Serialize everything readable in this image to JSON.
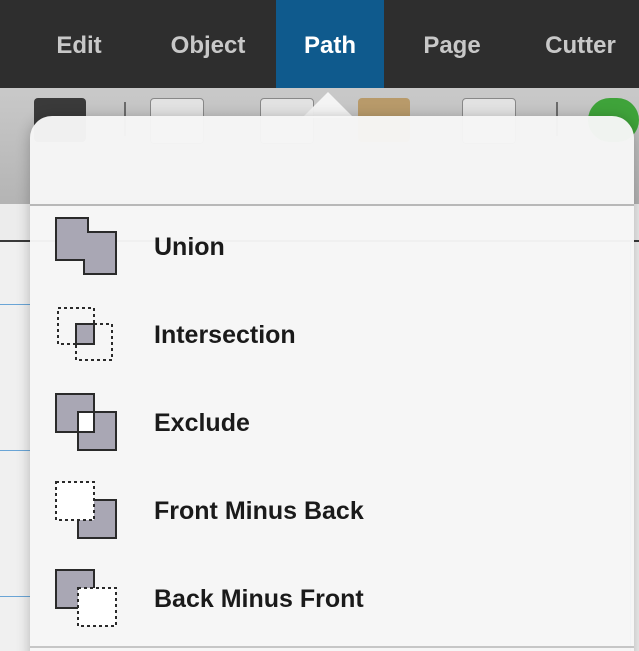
{
  "menubar": {
    "items": [
      {
        "label": "Edit",
        "active": false
      },
      {
        "label": "Object",
        "active": false
      },
      {
        "label": "Path",
        "active": true
      },
      {
        "label": "Page",
        "active": false
      },
      {
        "label": "Cutter",
        "active": false
      }
    ]
  },
  "path_menu": {
    "items": [
      {
        "label": "Union",
        "icon": "union-icon"
      },
      {
        "label": "Intersection",
        "icon": "intersection-icon"
      },
      {
        "label": "Exclude",
        "icon": "exclude-icon"
      },
      {
        "label": "Front Minus Back",
        "icon": "front-minus-back-icon"
      },
      {
        "label": "Back Minus Front",
        "icon": "back-minus-front-icon"
      }
    ]
  },
  "colors": {
    "menubar_bg": "#2e2e2e",
    "active_tab": "#0f5a8d",
    "shape_fill": "#a9a7b4",
    "shape_stroke": "#2a2a2a"
  }
}
